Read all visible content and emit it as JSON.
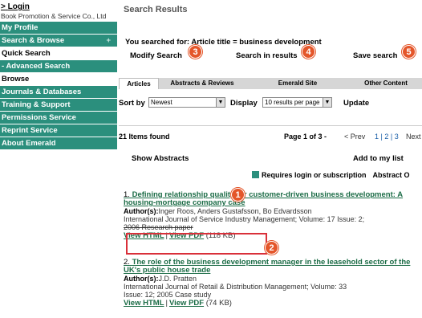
{
  "sidebar": {
    "login_prefix": ">",
    "login_label": "Login",
    "company": "Book Promotion & Service Co., Ltd",
    "items": [
      {
        "label": "My Profile",
        "style": "teal"
      },
      {
        "label": "Search & Browse",
        "style": "teal",
        "plus": "+"
      },
      {
        "label": "Quick Search",
        "style": "light"
      },
      {
        "label": "- Advanced Search",
        "style": "teal"
      },
      {
        "label": "Browse",
        "style": "light"
      },
      {
        "label": "Journals & Databases",
        "style": "teal"
      },
      {
        "label": "Training & Support",
        "style": "teal"
      },
      {
        "label": "Permissions Service",
        "style": "teal"
      },
      {
        "label": "Reprint Service",
        "style": "teal"
      },
      {
        "label": "About Emerald",
        "style": "teal"
      }
    ]
  },
  "main": {
    "title": "Search Results",
    "searched_for": "You searched for: Article title = business development",
    "modify_search": "Modify Search",
    "search_in_results": "Search in results",
    "save_search": "Save search",
    "tabs": [
      "Articles",
      "Abstracts & Reviews",
      "Emerald Site",
      "Other Content"
    ],
    "sort_label": "Sort by",
    "sort_value": "Newest",
    "display_label": "Display",
    "display_value": "10 results per page",
    "update_label": "Update",
    "items_found": "21 Items found",
    "page_of": "Page 1 of 3 -",
    "prev": "< Prev",
    "page_numbers": "1 | 2 | 3",
    "next": "Next",
    "show_abstracts": "Show Abstracts",
    "add_to_list": "Add to my list",
    "requires_login": "Requires login or subscription",
    "abstract_only": "Abstract O",
    "results": [
      {
        "num": "1.",
        "title": "Defining relationship quality for customer-driven business development: A housing-mortgage company case",
        "authors_label": "Author(s):",
        "authors": "Inger Roos, Anders Gustafsson, Bo Edvardsson",
        "journal": "International Journal of Service Industry Management; Volume: 17  Issue: 2;",
        "meta": "2006 Research paper",
        "html_link": "View HTML",
        "pdf_link": "View PDF",
        "size": "(118 KB)"
      },
      {
        "num": "2.",
        "title": "The role of the business development manager in the leasehold sector of the UK's public house trade",
        "authors_label": "Author(s):",
        "authors": "J.D. Pratten",
        "journal": "International Journal of Retail & Distribution Management; Volume: 33",
        "meta": "Issue: 12; 2005 Case study",
        "html_link": "View HTML",
        "pdf_link": "View PDF",
        "size": "(74 KB)"
      }
    ],
    "badges": [
      "1",
      "2",
      "3",
      "4",
      "5"
    ]
  },
  "colors": {
    "nav_teal": "#2b8f7d",
    "link_green": "#1a6b45",
    "badge_orange": "#e4562a",
    "highlight_red": "#d9303a"
  }
}
